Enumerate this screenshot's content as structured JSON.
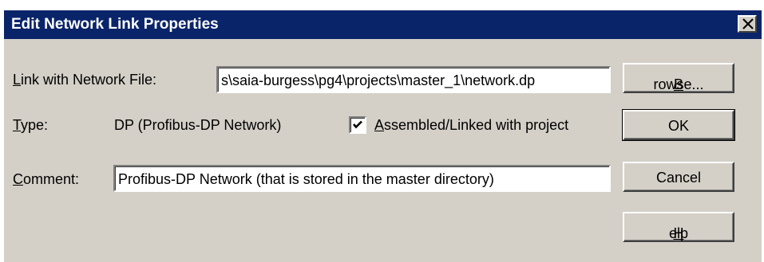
{
  "window": {
    "title": "Edit Network Link Properties",
    "close_icon": "close-icon"
  },
  "form": {
    "link_label_ul": "L",
    "link_label_rest": "ink with Network File:",
    "link_value": "s\\saia-burgess\\pg4\\projects\\master_1\\network.dp",
    "type_label_ul": "T",
    "type_label_rest": "ype:",
    "type_value": "DP (Profibus-DP Network)",
    "assembled_label_ul": "A",
    "assembled_label_rest": "ssembled/Linked with project",
    "assembled_checked": true,
    "comment_label_ul": "C",
    "comment_label_rest": "omment:",
    "comment_value": "Profibus-DP Network (that is stored in the master directory)"
  },
  "buttons": {
    "browse_ul": "B",
    "browse_rest": "rowse...",
    "ok": "OK",
    "cancel": "Cancel",
    "help_ul": "H",
    "help_rest": "elp"
  },
  "colors": {
    "titlebar": "#0a246a",
    "dialog_bg": "#d4d0c8"
  }
}
